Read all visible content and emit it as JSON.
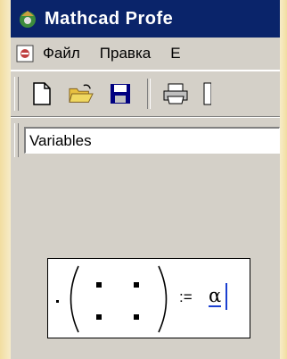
{
  "window": {
    "title": "Mathcad Profe",
    "app_icon": "mathcad-app-icon"
  },
  "menu": {
    "doc_icon": "document-icon",
    "items": [
      "Файл",
      "Правка",
      "E"
    ]
  },
  "toolbar": {
    "icons": [
      "new-document-icon",
      "open-folder-icon",
      "save-icon",
      "print-icon",
      "partial-icon"
    ]
  },
  "format": {
    "style_value": "Variables"
  },
  "worksheet": {
    "expression": {
      "matrix_placeholders": 4,
      "operator": ":=",
      "value": "α"
    }
  },
  "colors": {
    "title_bar": "#0a246a",
    "chrome": "#d4d0c8",
    "cursor": "#1a3fd0",
    "background": "#f5e9c4"
  }
}
